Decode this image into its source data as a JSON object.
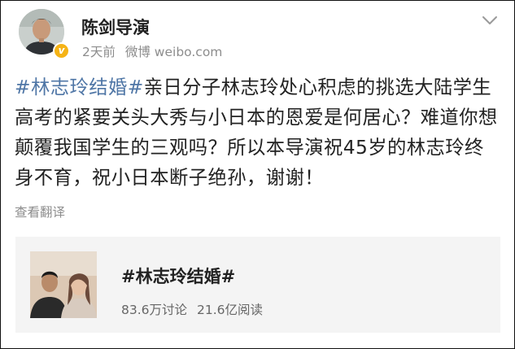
{
  "author": {
    "name": "陈剑导演",
    "verified_badge_color": "#f5b316"
  },
  "meta": {
    "time": "2天前",
    "source": "微博 weibo.com"
  },
  "post": {
    "segments": [
      {
        "text": "#林志玲结婚#",
        "style": "hashtag"
      },
      {
        "text": "亲日分子林志玲处心积虑的挑选大陆学生高考的紧要关头大秀与",
        "style": "plain"
      },
      {
        "text": "小日本的恩爱是何居心",
        "style": "underline"
      },
      {
        "text": "？难道你想颠覆我国学生的三观吗？所以",
        "style": "plain"
      },
      {
        "text": "本导演祝45岁的林志玲终身不育",
        "style": "underline"
      },
      {
        "text": "，祝小日本断子绝孙，谢谢！",
        "style": "plain"
      }
    ],
    "translate_label": "查看翻译",
    "underline_color": "#e0162b",
    "hashtag_color": "#4f76a6"
  },
  "topic_card": {
    "title": "#林志玲结婚#",
    "discussions": "83.6万讨论",
    "reads": "21.6亿阅读"
  },
  "icons": [
    "more-chevron-icon",
    "verified-badge-icon"
  ]
}
